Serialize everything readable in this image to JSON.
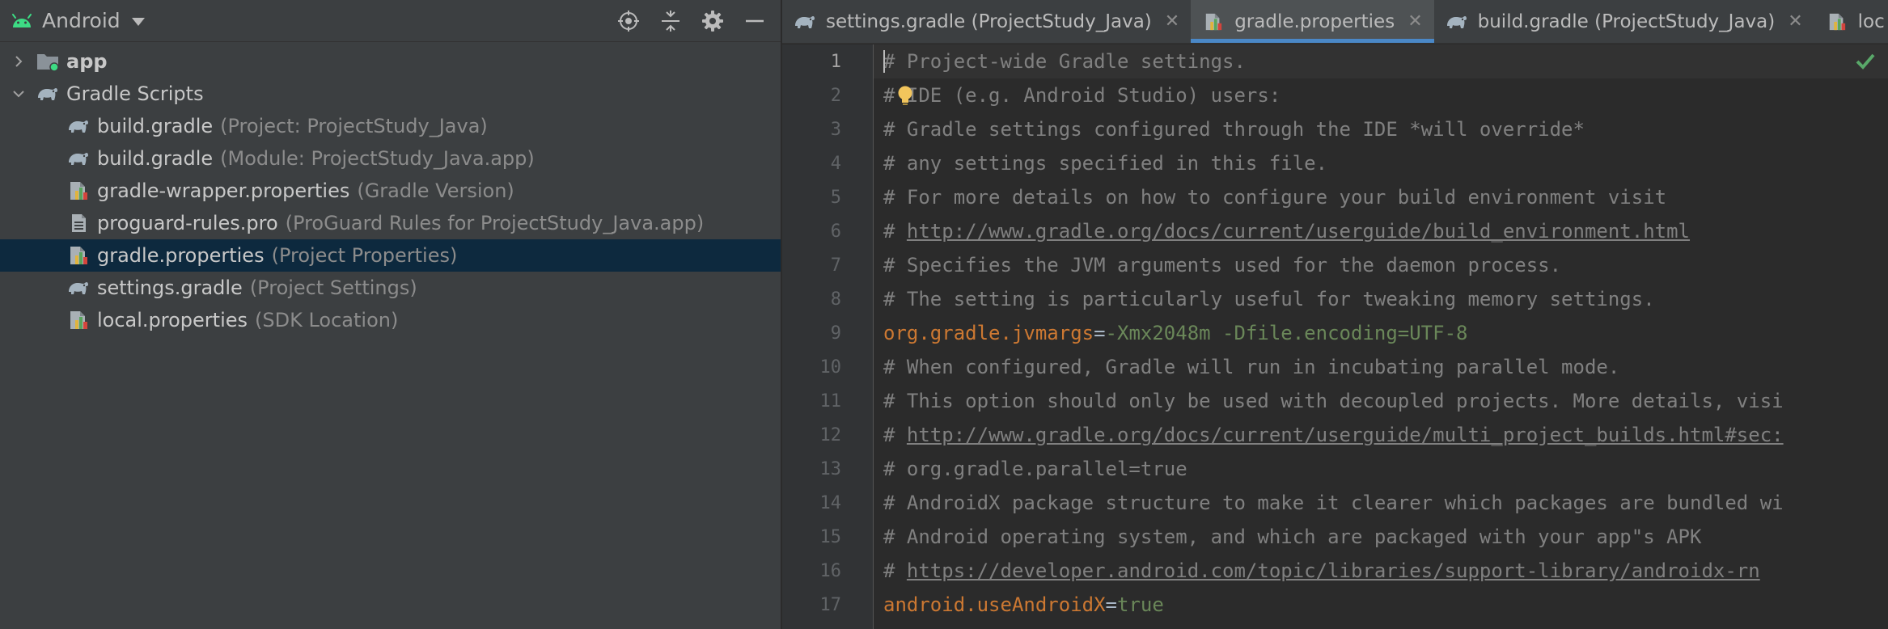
{
  "project_panel": {
    "view_name": "Android",
    "toolbar": [
      {
        "name": "locate-icon"
      },
      {
        "name": "collapse-all-icon"
      },
      {
        "name": "gear-icon"
      },
      {
        "name": "minimize-icon"
      }
    ],
    "tree": [
      {
        "level": 0,
        "expanded": false,
        "icon": "app-module-icon",
        "name": "app",
        "bold": true,
        "hint": ""
      },
      {
        "level": 0,
        "expanded": true,
        "icon": "gradle-icon",
        "name": "Gradle Scripts",
        "bold": false,
        "hint": ""
      },
      {
        "level": 1,
        "icon": "gradle-icon",
        "name": "build.gradle",
        "hint": "(Project: ProjectStudy_Java)"
      },
      {
        "level": 1,
        "icon": "gradle-icon",
        "name": "build.gradle",
        "hint": "(Module: ProjectStudy_Java.app)"
      },
      {
        "level": 1,
        "icon": "properties-icon",
        "name": "gradle-wrapper.properties",
        "hint": "(Gradle Version)"
      },
      {
        "level": 1,
        "icon": "text-file-icon",
        "name": "proguard-rules.pro",
        "hint": "(ProGuard Rules for ProjectStudy_Java.app)"
      },
      {
        "level": 1,
        "icon": "properties-icon",
        "name": "gradle.properties",
        "hint": "(Project Properties)",
        "selected": true
      },
      {
        "level": 1,
        "icon": "gradle-icon",
        "name": "settings.gradle",
        "hint": "(Project Settings)"
      },
      {
        "level": 1,
        "icon": "properties-icon",
        "name": "local.properties",
        "hint": "(SDK Location)"
      }
    ]
  },
  "tabs": [
    {
      "icon": "gradle-icon",
      "label": "settings.gradle (ProjectStudy_Java)",
      "active": false,
      "close": "✕"
    },
    {
      "icon": "properties-icon",
      "label": "gradle.properties",
      "active": true,
      "close": "✕"
    },
    {
      "icon": "gradle-icon",
      "label": "build.gradle (ProjectStudy_Java)",
      "active": false,
      "close": "✕"
    },
    {
      "icon": "properties-icon",
      "label": "loc",
      "active": false,
      "close": ""
    }
  ],
  "editor": {
    "current_line": 1,
    "lines": [
      {
        "n": "1",
        "parts": [
          {
            "t": "# Project-wide Gradle settings.",
            "c": "comment"
          }
        ]
      },
      {
        "n": "2",
        "parts": [
          {
            "t": "# IDE (e.g. Android Studio) users:",
            "c": "comment"
          }
        ]
      },
      {
        "n": "3",
        "parts": [
          {
            "t": "# Gradle settings configured through the IDE *will override*",
            "c": "comment"
          }
        ]
      },
      {
        "n": "4",
        "parts": [
          {
            "t": "# any settings specified in this file.",
            "c": "comment"
          }
        ]
      },
      {
        "n": "5",
        "parts": [
          {
            "t": "# For more details on how to configure your build environment visit",
            "c": "comment"
          }
        ]
      },
      {
        "n": "6",
        "parts": [
          {
            "t": "# ",
            "c": "comment"
          },
          {
            "t": "http://www.gradle.org/docs/current/userguide/build_environment.html",
            "c": "link"
          }
        ]
      },
      {
        "n": "7",
        "parts": [
          {
            "t": "# Specifies the JVM arguments used for the daemon process.",
            "c": "comment"
          }
        ]
      },
      {
        "n": "8",
        "parts": [
          {
            "t": "# The setting is particularly useful for tweaking memory settings.",
            "c": "comment"
          }
        ]
      },
      {
        "n": "9",
        "parts": [
          {
            "t": "org.gradle.jvmargs",
            "c": "key"
          },
          {
            "t": "=",
            "c": "eq"
          },
          {
            "t": "-Xmx2048m -Dfile.encoding=UTF-8",
            "c": "val"
          }
        ]
      },
      {
        "n": "10",
        "parts": [
          {
            "t": "# When configured, Gradle will run in incubating parallel mode.",
            "c": "comment"
          }
        ]
      },
      {
        "n": "11",
        "parts": [
          {
            "t": "# This option should only be used with decoupled projects. More details, visi",
            "c": "comment"
          }
        ]
      },
      {
        "n": "12",
        "parts": [
          {
            "t": "# ",
            "c": "comment"
          },
          {
            "t": "http://www.gradle.org/docs/current/userguide/multi_project_builds.html#sec:",
            "c": "link"
          }
        ]
      },
      {
        "n": "13",
        "parts": [
          {
            "t": "# org.gradle.parallel=true",
            "c": "comment"
          }
        ]
      },
      {
        "n": "14",
        "parts": [
          {
            "t": "# AndroidX package structure to make it clearer which packages are bundled wi",
            "c": "comment"
          }
        ]
      },
      {
        "n": "15",
        "parts": [
          {
            "t": "# Android operating system, and which are packaged with your app\"s APK",
            "c": "comment"
          }
        ]
      },
      {
        "n": "16",
        "parts": [
          {
            "t": "# ",
            "c": "comment"
          },
          {
            "t": "https://developer.android.com/topic/libraries/support-library/androidx-rn",
            "c": "link"
          }
        ]
      },
      {
        "n": "17",
        "parts": [
          {
            "t": "android.useAndroidX",
            "c": "key"
          },
          {
            "t": "=",
            "c": "eq"
          },
          {
            "t": "true",
            "c": "val"
          }
        ]
      }
    ]
  },
  "colors": {
    "panel_bg": "#3c3f41",
    "editor_bg": "#2b2b2b",
    "selection": "#0d293e",
    "comment": "#808080",
    "key": "#cc7832",
    "value": "#6a8759",
    "tab_underline": "#4a88c7",
    "android_green": "#3ddc84"
  }
}
